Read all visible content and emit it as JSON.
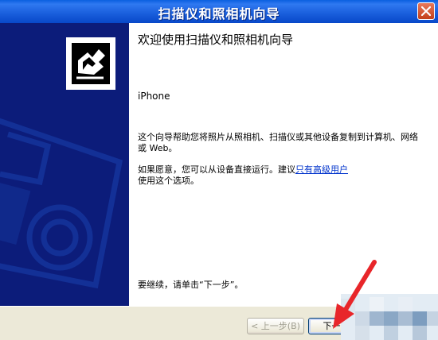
{
  "window": {
    "title": "扫描仪和照相机向导"
  },
  "content": {
    "heading": "欢迎使用扫描仪和照相机向导",
    "device_name": "iPhone",
    "description": "这个向导帮助您将照片从照相机、扫描仪或其他设备复制到计算机、网络或 Web。",
    "advanced_text": "如果愿意，您可以从设备直接运行。建议",
    "advanced_link": "只有高级用户",
    "advanced_suffix": "使用这个选项。",
    "continue_text": "要继续，请单击“下一步”。"
  },
  "buttons": {
    "back": "< 上一步(B)",
    "next": "下一步"
  },
  "colors": {
    "titlebar": "#1b61de",
    "side_panel": "#0c1c7a",
    "annotation_arrow": "#e8262a"
  }
}
